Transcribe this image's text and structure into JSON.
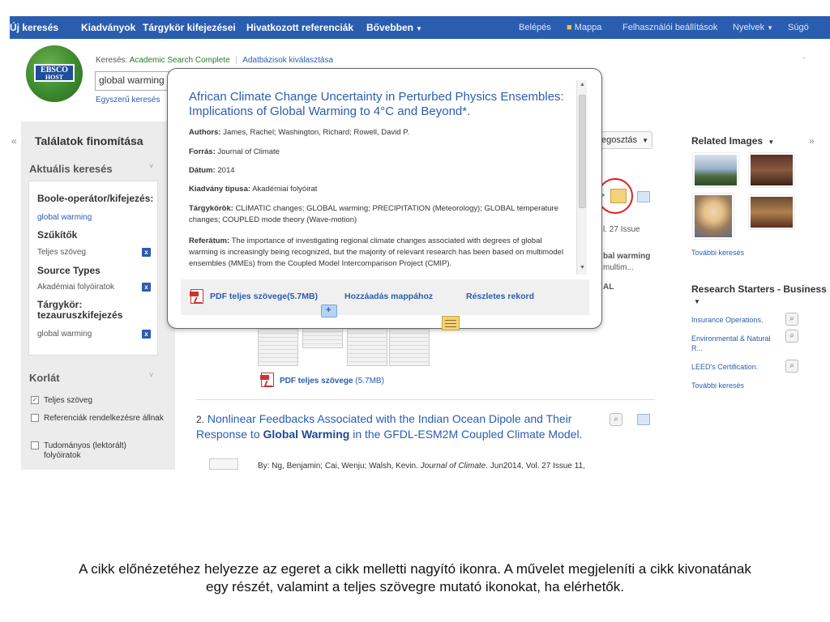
{
  "topnav": {
    "items": [
      "Új keresés",
      "Kiadványok",
      "Tárgykör kifejezései",
      "Hivatkozott referenciák",
      "Bővebben"
    ],
    "right": [
      "Belépés",
      "Mappa",
      "Felhasználói beállítások",
      "Nyelvek",
      "Súgó"
    ]
  },
  "header": {
    "logo_top": "EBSCO",
    "logo_bottom": "HOST",
    "search_label": "Keresés:",
    "database": "Academic Search Complete",
    "choose_db": "Adatbázisok kiválasztása",
    "search_value": "global warming",
    "simple_search": "Egyszerű keresés"
  },
  "sidebar": {
    "title": "Találatok finomítása",
    "current_search": "Aktuális keresés",
    "boolean_heading": "Boole-operátor/kifejezés:",
    "boolean_value": "global warming",
    "limiters_heading": "Szűkítők",
    "limiter": "Teljes szöveg",
    "source_types_heading": "Source Types",
    "source_type": "Akadémiai folyóiratok",
    "subject_heading": "Tárgykör: tezauruszkifejezés",
    "subject_value": "global warming",
    "limit_title": "Korlát",
    "checkboxes": [
      {
        "label": "Teljes szöveg",
        "checked": true
      },
      {
        "label": "Referenciák rendelkezésre állnak",
        "checked": false
      },
      {
        "label": "Tudományos (lektorált) folyóiratok",
        "checked": false
      }
    ]
  },
  "results": {
    "sort_label": "egosztás",
    "ghost_issue": "l. 27 Issue",
    "ghost_bal": "bal warming",
    "ghost_multim": "multim...",
    "ghost_al": "AL",
    "pdf_label": "PDF teljes szövege",
    "pdf_size": "(5.7MB)",
    "result2_num": "2.",
    "result2_title_a": "Nonlinear Feedbacks Associated with the Indian Ocean Dipole and Their Response to",
    "result2_title_b": "Global Warming",
    "result2_title_c": "in the GFDL-ESM2M Coupled Climate Model.",
    "result2_by": "By: Ng, Benjamin; Cai, Wenju; Walsh, Kevin.",
    "result2_journal": "Journal of Climate",
    "result2_date": ". Jun2014, Vol. 27 Issue 11,"
  },
  "popup": {
    "title": "African Climate Change Uncertainty in Perturbed Physics Ensembles: Implications of Global Warming to 4°C and Beyond*.",
    "authors_label": "Authors:",
    "authors": "James, Rachel; Washington, Richard; Rowell, David P.",
    "source_label": "Forrás:",
    "source": "Journal of Climate",
    "date_label": "Dátum:",
    "date": "2014",
    "pubtype_label": "Kiadvány típusa:",
    "pubtype": "Akadémiai folyóirat",
    "subjects_label": "Tárgykörök:",
    "subjects": "CLIMATIC changes; GLOBAL warming; PRECIPITATION (Meteorology); GLOBAL temperature changes; COUPLED mode theory (Wave-motion)",
    "abstract_label": "Referátum:",
    "abstract": "The importance of investigating regional climate changes associated with degrees of global warming is increasingly being recognized, but the majority of relevant research has been based on multimodel ensembles (MMEs) from the Coupled Model Intercomparison Project (CMIP).",
    "pdf_link": "PDF teljes szövege",
    "pdf_size": "(5.7MB)",
    "add_folder": "Hozzáadás mappához",
    "detailed": "Részletes rekord"
  },
  "right": {
    "related_images": "Related Images",
    "more_search": "További keresés",
    "rs_title": "Research Starters - Business",
    "rs_items": [
      "Insurance Operations.",
      "Environmental & Natural R...",
      "LEED's Certification."
    ],
    "rs_more": "További keresés"
  },
  "caption": {
    "line1": "A cikk előnézetéhez helyezze az egeret a cikk melletti nagyító ikonra. A művelet megjeleníti a cikk kivonatának",
    "line2": "egy részét, valamint a teljes szövegre mutató ikonokat, ha elérhetők."
  },
  "colors": {
    "nav_bg": "#2a5db0",
    "link": "#2a5db0",
    "highlight_circle": "#e02020"
  }
}
